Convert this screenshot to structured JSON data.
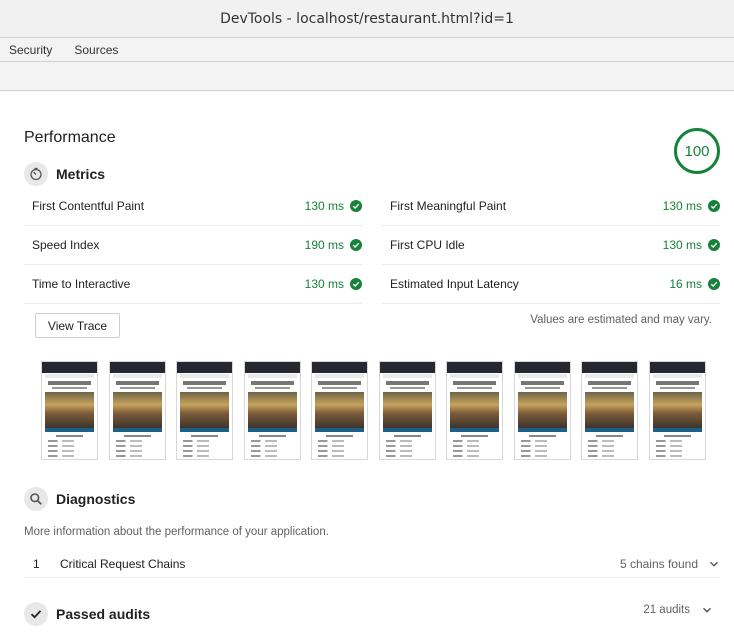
{
  "window": {
    "title": "DevTools - localhost/restaurant.html?id=1"
  },
  "tabs": [
    "Security",
    "Sources"
  ],
  "performance": {
    "title": "Performance",
    "score": "100",
    "colors": {
      "pass": "#178239"
    }
  },
  "metrics": {
    "title": "Metrics",
    "icon": "timer-icon",
    "items": [
      {
        "label": "First Contentful Paint",
        "value": "130 ms"
      },
      {
        "label": "First Meaningful Paint",
        "value": "130 ms"
      },
      {
        "label": "Speed Index",
        "value": "190 ms"
      },
      {
        "label": "First CPU Idle",
        "value": "130 ms"
      },
      {
        "label": "Time to Interactive",
        "value": "130 ms"
      },
      {
        "label": "Estimated Input Latency",
        "value": "16 ms"
      }
    ],
    "view_trace_label": "View Trace",
    "estimate_note": "Values are estimated and may vary."
  },
  "diagnostics": {
    "title": "Diagnostics",
    "icon": "search-icon",
    "description": "More information about the performance of your application.",
    "rows": [
      {
        "index": "1",
        "label": "Critical Request Chains",
        "value": "5 chains found"
      }
    ]
  },
  "passed": {
    "title": "Passed audits",
    "icon": "checkmark-icon",
    "count": "21 audits"
  }
}
